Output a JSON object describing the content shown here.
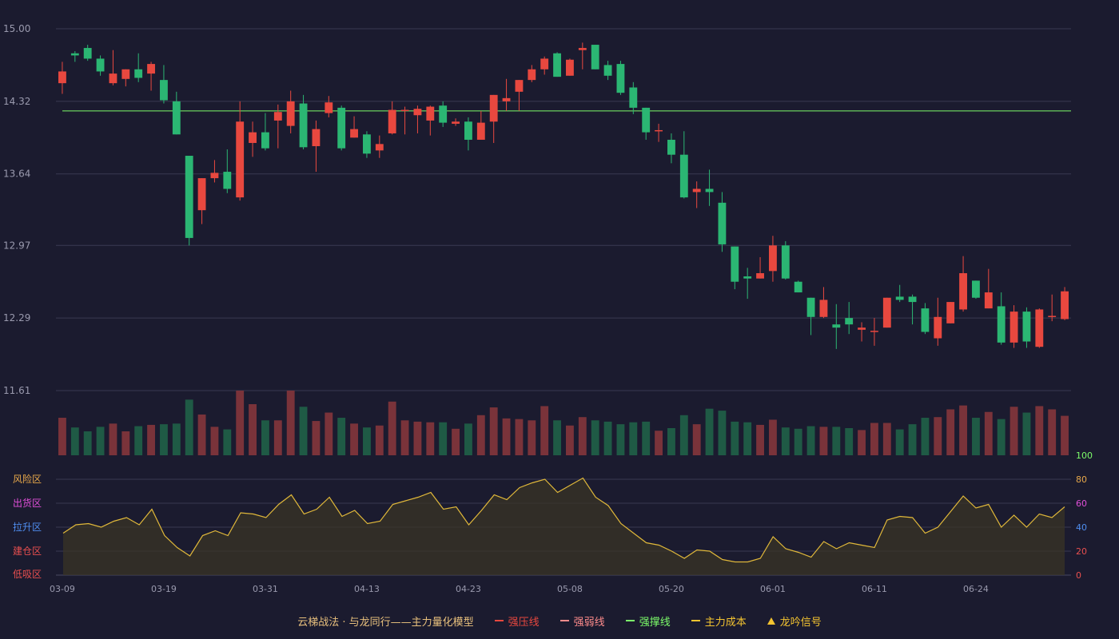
{
  "colors": {
    "up": "#e8483f",
    "down": "#2bb673",
    "up_vol": "#7a333a",
    "down_vol": "#1f5a45",
    "support": "#7cfc6a",
    "osc_line": "#e0b83a",
    "grid": "#3a3a52",
    "text": "#9a9aae"
  },
  "legend": {
    "title": "云梯战法 · 与龙同行——主力量化模型",
    "items": [
      {
        "label": "强压线",
        "color": "#e8483f",
        "style": "solid"
      },
      {
        "label": "强弱线",
        "color": "#ff8c8c",
        "style": "dashed"
      },
      {
        "label": "强撑线",
        "color": "#7cfc6a",
        "style": "solid"
      },
      {
        "label": "主力成本",
        "color": "#f4c430",
        "style": "dashed"
      },
      {
        "label": "龙吟信号",
        "color": "#f4c430",
        "style": "triangle"
      }
    ]
  },
  "zones": [
    {
      "label": "风险区",
      "color": "#e8a84a"
    },
    {
      "label": "出货区",
      "color": "#e04fd8"
    },
    {
      "label": "拉升区",
      "color": "#4f8ef0"
    },
    {
      "label": "建仓区",
      "color": "#e84f4f"
    },
    {
      "label": "低吸区",
      "color": "#e84f4f"
    }
  ],
  "chart_data": [
    {
      "type": "candlestick",
      "y_ticks": [
        "15.00",
        "14.32",
        "13.64",
        "12.97",
        "12.29",
        "11.61"
      ],
      "ylim": [
        11.61,
        15.0
      ],
      "x_tick_labels": [
        "03-09",
        "03-19",
        "03-31",
        "04-13",
        "04-23",
        "05-08",
        "05-20",
        "06-01",
        "06-11",
        "06-24"
      ],
      "x_tick_indices": [
        0,
        8,
        16,
        24,
        32,
        40,
        48,
        56,
        64,
        72
      ],
      "support_line": 14.23,
      "ohlc": [
        [
          14.49,
          14.6,
          14.39,
          14.69
        ],
        [
          14.77,
          14.75,
          14.69,
          14.79
        ],
        [
          14.82,
          14.72,
          14.7,
          14.85
        ],
        [
          14.72,
          14.6,
          14.56,
          14.75
        ],
        [
          14.49,
          14.58,
          14.47,
          14.8
        ],
        [
          14.53,
          14.62,
          14.46,
          14.62
        ],
        [
          14.62,
          14.54,
          14.5,
          14.77
        ],
        [
          14.58,
          14.67,
          14.42,
          14.69
        ],
        [
          14.52,
          14.33,
          14.3,
          14.66
        ],
        [
          14.32,
          14.01,
          14.01,
          14.41
        ],
        [
          13.81,
          13.04,
          12.97,
          13.81
        ],
        [
          13.3,
          13.6,
          13.17,
          13.6
        ],
        [
          13.6,
          13.65,
          13.56,
          13.77
        ],
        [
          13.66,
          13.5,
          13.46,
          13.87
        ],
        [
          13.42,
          14.13,
          13.39,
          14.32
        ],
        [
          13.93,
          14.03,
          13.8,
          14.13
        ],
        [
          14.03,
          13.88,
          13.86,
          14.21
        ],
        [
          14.14,
          14.22,
          13.88,
          14.29
        ],
        [
          14.09,
          14.32,
          14.02,
          14.42
        ],
        [
          14.3,
          13.89,
          13.87,
          14.38
        ],
        [
          13.9,
          14.06,
          13.66,
          14.14
        ],
        [
          14.21,
          14.31,
          14.17,
          14.37
        ],
        [
          14.26,
          13.88,
          13.86,
          14.28
        ],
        [
          13.98,
          14.06,
          13.98,
          14.18
        ],
        [
          14.01,
          13.83,
          13.79,
          14.04
        ],
        [
          13.86,
          13.92,
          13.79,
          14.0
        ],
        [
          14.02,
          14.24,
          14.01,
          14.32
        ],
        [
          14.23,
          14.24,
          14.01,
          14.27
        ],
        [
          14.19,
          14.25,
          14.02,
          14.28
        ],
        [
          14.14,
          14.27,
          14.0,
          14.28
        ],
        [
          14.28,
          14.12,
          14.08,
          14.32
        ],
        [
          14.11,
          14.13,
          14.09,
          14.16
        ],
        [
          14.13,
          13.96,
          13.86,
          14.17
        ],
        [
          13.96,
          14.12,
          13.96,
          14.23
        ],
        [
          14.13,
          14.38,
          13.93,
          14.38
        ],
        [
          14.32,
          14.35,
          14.23,
          14.53
        ],
        [
          14.41,
          14.52,
          14.23,
          14.52
        ],
        [
          14.52,
          14.62,
          14.5,
          14.66
        ],
        [
          14.62,
          14.72,
          14.57,
          14.74
        ],
        [
          14.77,
          14.55,
          14.55,
          14.78
        ],
        [
          14.56,
          14.71,
          14.56,
          14.72
        ],
        [
          14.8,
          14.82,
          14.62,
          14.87
        ],
        [
          14.85,
          14.62,
          14.62,
          14.85
        ],
        [
          14.66,
          14.56,
          14.52,
          14.7
        ],
        [
          14.67,
          14.4,
          14.38,
          14.7
        ],
        [
          14.45,
          14.26,
          14.2,
          14.5
        ],
        [
          14.26,
          14.03,
          13.96,
          14.26
        ],
        [
          14.05,
          14.05,
          13.94,
          14.11
        ],
        [
          13.96,
          13.82,
          13.74,
          14.02
        ],
        [
          13.82,
          13.42,
          13.41,
          14.04
        ],
        [
          13.47,
          13.5,
          13.32,
          13.57
        ],
        [
          13.5,
          13.47,
          13.34,
          13.68
        ],
        [
          13.37,
          12.98,
          12.91,
          13.47
        ],
        [
          12.96,
          12.63,
          12.56,
          12.96
        ],
        [
          12.68,
          12.66,
          12.47,
          12.76
        ],
        [
          12.66,
          12.71,
          12.66,
          12.86
        ],
        [
          12.73,
          12.97,
          12.63,
          13.06
        ],
        [
          12.97,
          12.66,
          12.65,
          13.01
        ],
        [
          12.63,
          12.53,
          12.53,
          12.64
        ],
        [
          12.48,
          12.3,
          12.13,
          12.48
        ],
        [
          12.3,
          12.46,
          12.29,
          12.58
        ],
        [
          12.23,
          12.2,
          12.0,
          12.42
        ],
        [
          12.29,
          12.23,
          12.14,
          12.44
        ],
        [
          12.18,
          12.2,
          12.07,
          12.25
        ],
        [
          12.16,
          12.17,
          12.03,
          12.29
        ],
        [
          12.2,
          12.48,
          12.2,
          12.48
        ],
        [
          12.49,
          12.46,
          12.44,
          12.6
        ],
        [
          12.49,
          12.44,
          12.23,
          12.51
        ],
        [
          12.38,
          12.16,
          12.14,
          12.43
        ],
        [
          12.1,
          12.3,
          12.03,
          12.48
        ],
        [
          12.24,
          12.44,
          12.24,
          12.44
        ],
        [
          12.37,
          12.71,
          12.35,
          12.87
        ],
        [
          12.64,
          12.48,
          12.47,
          12.64
        ],
        [
          12.38,
          12.53,
          12.38,
          12.75
        ],
        [
          12.4,
          12.06,
          12.04,
          12.53
        ],
        [
          12.06,
          12.35,
          12.01,
          12.41
        ],
        [
          12.35,
          12.07,
          12.01,
          12.39
        ],
        [
          12.02,
          12.37,
          12.01,
          12.38
        ],
        [
          12.31,
          12.31,
          12.26,
          12.51
        ],
        [
          12.28,
          12.54,
          12.27,
          12.58
        ]
      ],
      "volume": [
        0.58,
        0.43,
        0.37,
        0.44,
        0.49,
        0.37,
        0.45,
        0.47,
        0.48,
        0.49,
        0.86,
        0.63,
        0.44,
        0.4,
        1.0,
        0.79,
        0.54,
        0.54,
        1.0,
        0.75,
        0.53,
        0.66,
        0.58,
        0.49,
        0.43,
        0.46,
        0.83,
        0.54,
        0.52,
        0.51,
        0.51,
        0.41,
        0.49,
        0.62,
        0.74,
        0.57,
        0.56,
        0.54,
        0.76,
        0.54,
        0.46,
        0.59,
        0.54,
        0.52,
        0.48,
        0.51,
        0.52,
        0.38,
        0.42,
        0.62,
        0.48,
        0.72,
        0.69,
        0.52,
        0.51,
        0.47,
        0.55,
        0.43,
        0.41,
        0.45,
        0.44,
        0.44,
        0.42,
        0.39,
        0.5,
        0.5,
        0.4,
        0.48,
        0.58,
        0.59,
        0.71,
        0.77,
        0.58,
        0.67,
        0.56,
        0.75,
        0.66,
        0.76,
        0.71,
        0.61
      ]
    },
    {
      "type": "area",
      "y_ticks": [
        "0",
        "20",
        "40",
        "60",
        "80",
        "100"
      ],
      "ylim": [
        0,
        100
      ],
      "values": [
        35,
        42,
        43,
        40,
        45,
        48,
        42,
        55,
        33,
        23,
        16,
        33,
        37,
        33,
        52,
        51,
        48,
        59,
        67,
        51,
        55,
        65,
        49,
        54,
        43,
        45,
        59,
        62,
        65,
        69,
        55,
        57,
        42,
        54,
        67,
        63,
        73,
        77,
        80,
        69,
        75,
        81,
        65,
        58,
        43,
        35,
        27,
        25,
        20,
        14,
        21,
        20,
        13,
        11,
        11,
        14,
        32,
        22,
        19,
        15,
        28,
        22,
        27,
        25,
        23,
        46,
        49,
        48,
        35,
        40,
        53,
        66,
        56,
        59,
        40,
        50,
        40,
        51,
        48,
        57
      ]
    }
  ]
}
